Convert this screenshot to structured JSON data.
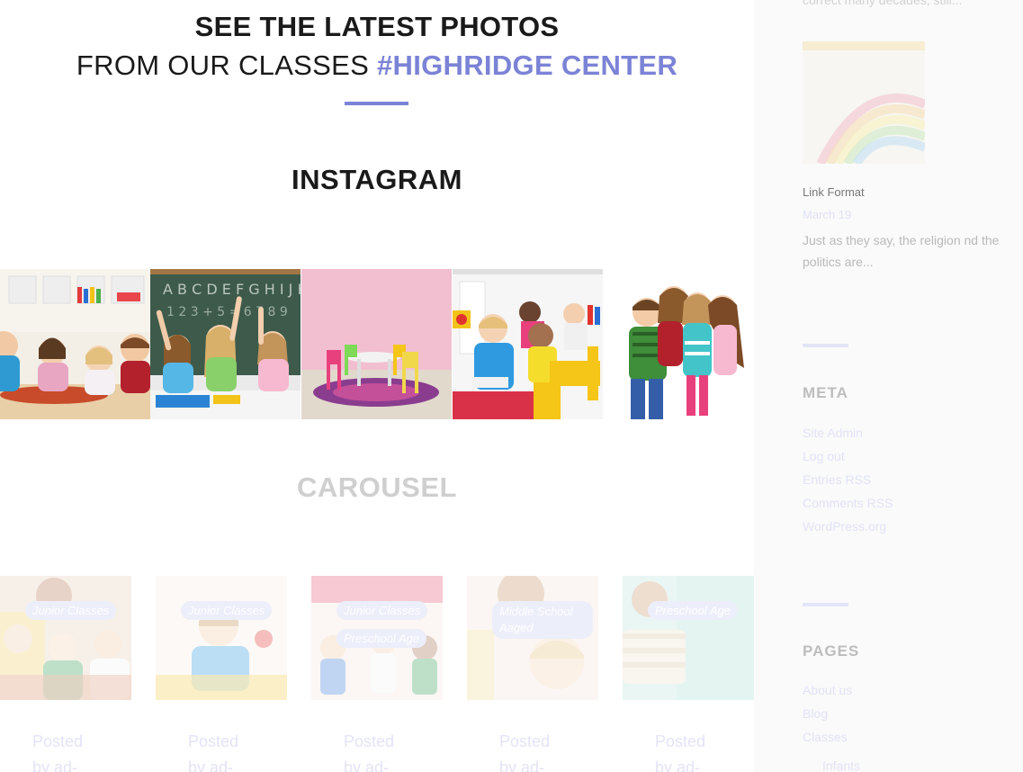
{
  "hero": {
    "line1": "SEE THE LATEST PHOTOS",
    "line2_plain": "FROM OUR CLASSES ",
    "line2_accent": "#HIGHRIDGE CENTER"
  },
  "instagram": {
    "title": "INSTAGRAM"
  },
  "carousel": {
    "title": "CAROUSEL",
    "cards": [
      {
        "tags": [
          "Junior Classes"
        ],
        "posted": "Posted",
        "by": "by ad-"
      },
      {
        "tags": [
          "Junior Classes"
        ],
        "posted": "Posted",
        "by": "by ad-"
      },
      {
        "tags": [
          "Junior Classes",
          "Preschool Age"
        ],
        "posted": "Posted",
        "by": "by ad-"
      },
      {
        "tags": [
          "Middle School Aaged"
        ],
        "posted": "Posted",
        "by": "by ad-"
      },
      {
        "tags": [
          "Preschool Age"
        ],
        "posted": "Posted",
        "by": "by ad-"
      }
    ]
  },
  "sidebar": {
    "top_excerpt": "correct many decades, still...",
    "post": {
      "title": "Link Format",
      "date": "March 19",
      "excerpt": "Just as they say, the religion nd the politics are..."
    },
    "meta": {
      "heading": "META",
      "items": [
        "Site Admin",
        "Log out",
        "Entries RSS",
        "Comments RSS",
        "WordPress.org"
      ]
    },
    "pages": {
      "heading": "PAGES",
      "items": [
        "About us",
        "Blog",
        "Classes",
        "Infants"
      ]
    }
  },
  "colors": {
    "accent": "#7b83d6"
  }
}
